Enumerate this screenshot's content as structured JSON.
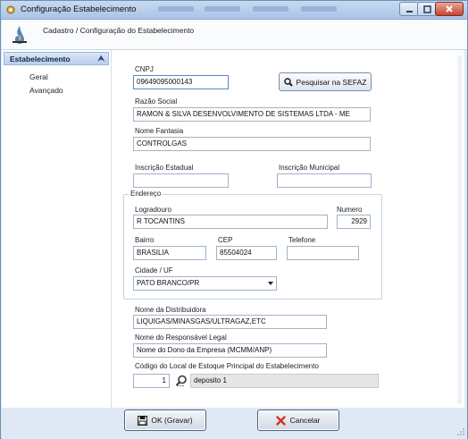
{
  "window": {
    "title": "Configuração Estabelecimento",
    "controls": {
      "minimize_icon": "minimize-icon",
      "maximize_icon": "maximize-icon",
      "close_icon": "close-icon"
    }
  },
  "header": {
    "breadcrumb": "Cadastro / Configuração do Estabelecimento"
  },
  "sidebar": {
    "section_title": "Estabelecimento",
    "collapse_glyph": "⮝",
    "items": [
      {
        "label": "Geral"
      },
      {
        "label": "Avançado"
      }
    ]
  },
  "form": {
    "cnpj": {
      "label": "CNPJ",
      "value": "09649095000143"
    },
    "search_button": {
      "label": "Pesquisar na SEFAZ",
      "icon": "search-icon"
    },
    "razao_social": {
      "label": "Razão Social",
      "value": "RAMON & SILVA DESENVOLVIMENTO DE SISTEMAS LTDA - ME"
    },
    "nome_fantasia": {
      "label": "Nome Fantasia",
      "value": "CONTROLGAS"
    },
    "inscricao_estadual": {
      "label": "Inscrição Estadual",
      "value": ""
    },
    "inscricao_municipal": {
      "label": "Inscrição Municipal",
      "value": ""
    },
    "endereco": {
      "group_title": "Endereço",
      "logradouro": {
        "label": "Logradouro",
        "value": "R TOCANTINS"
      },
      "numero": {
        "label": "Numero",
        "value": "2929"
      },
      "bairro": {
        "label": "Bairro",
        "value": "BRASILIA"
      },
      "cep": {
        "label": "CEP",
        "value": "85504024"
      },
      "telefone": {
        "label": "Telefone",
        "value": ""
      },
      "cidade_uf": {
        "label": "Cidade / UF",
        "value": "PATO BRANCO/PR"
      }
    },
    "distribuidora": {
      "label": "Nome da Distribuidora",
      "value": "LIQUIGAS/MINASGAS/ULTRAGAZ,ETC"
    },
    "responsavel": {
      "label": "Nome do Responsável Legal",
      "value": "Nome do Dono  da Empresa (MCMM/ANP)"
    },
    "estoque": {
      "label": "Código do Local de Estoque Principal do Estabelecimento",
      "code": "1",
      "description": "deposito 1",
      "lookup_icon": "lookup-search-icon"
    }
  },
  "footer": {
    "ok_button": {
      "label": "OK (Gravar)",
      "icon": "save-icon"
    },
    "cancel_button": {
      "label": "Cancelar",
      "icon": "cancel-x-icon"
    }
  },
  "colors": {
    "frame": "#dfe9f5",
    "titlebar": "#a9c4e6",
    "accent_red": "#d0361f"
  }
}
